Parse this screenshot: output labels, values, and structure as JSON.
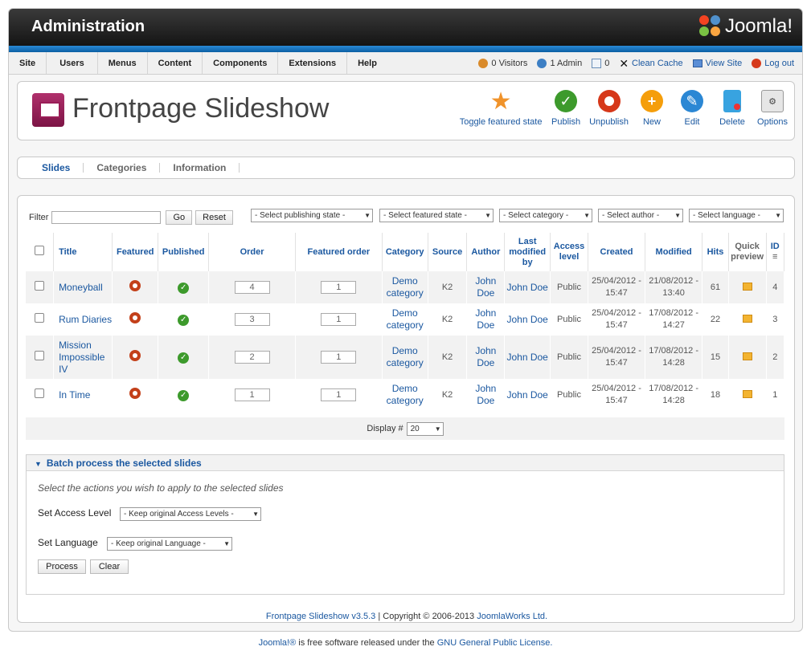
{
  "header": {
    "title": "Administration",
    "brand": "Joomla!"
  },
  "menu": [
    "Site",
    "Users",
    "Menus",
    "Content",
    "Components",
    "Extensions",
    "Help"
  ],
  "status": {
    "visitors": "0 Visitors",
    "admins": "1 Admin",
    "messages": "0",
    "clean_cache": "Clean Cache",
    "view_site": "View Site",
    "logout": "Log out"
  },
  "page_title": "Frontpage Slideshow",
  "toolbar": [
    {
      "label": "Toggle featured state",
      "icon": "star-icon"
    },
    {
      "label": "Publish",
      "icon": "check-icon"
    },
    {
      "label": "Unpublish",
      "icon": "unpublish-icon"
    },
    {
      "label": "New",
      "icon": "plus-icon"
    },
    {
      "label": "Edit",
      "icon": "pencil-icon"
    },
    {
      "label": "Delete",
      "icon": "trash-icon"
    },
    {
      "label": "Options",
      "icon": "options-icon"
    }
  ],
  "tabs": [
    "Slides",
    "Categories",
    "Information"
  ],
  "filter": {
    "label": "Filter",
    "go": "Go",
    "reset": "Reset",
    "selects": [
      "- Select publishing state -",
      "- Select featured state -",
      "- Select category -",
      "- Select author -",
      "- Select language -"
    ]
  },
  "columns": {
    "title": "Title",
    "featured": "Featured",
    "published": "Published",
    "order": "Order",
    "featured_order": "Featured order",
    "category": "Category",
    "source": "Source",
    "author": "Author",
    "last_modified_by": "Last modified by",
    "access": "Access level",
    "created": "Created",
    "modified": "Modified",
    "hits": "Hits",
    "quick_preview": "Quick preview",
    "id": "ID"
  },
  "rows": [
    {
      "title": "Moneyball",
      "order": "4",
      "featured_order": "1",
      "category": "Demo category",
      "source": "K2",
      "author": "John Doe",
      "modified_by": "John Doe",
      "access": "Public",
      "created": "25/04/2012 - 15:47",
      "modified": "21/08/2012 - 13:40",
      "hits": "61",
      "id": "4"
    },
    {
      "title": "Rum Diaries",
      "order": "3",
      "featured_order": "1",
      "category": "Demo category",
      "source": "K2",
      "author": "John Doe",
      "modified_by": "John Doe",
      "access": "Public",
      "created": "25/04/2012 - 15:47",
      "modified": "17/08/2012 - 14:27",
      "hits": "22",
      "id": "3"
    },
    {
      "title": "Mission Impossible IV",
      "order": "2",
      "featured_order": "1",
      "category": "Demo category",
      "source": "K2",
      "author": "John Doe",
      "modified_by": "John Doe",
      "access": "Public",
      "created": "25/04/2012 - 15:47",
      "modified": "17/08/2012 - 14:28",
      "hits": "15",
      "id": "2"
    },
    {
      "title": "In Time",
      "order": "1",
      "featured_order": "1",
      "category": "Demo category",
      "source": "K2",
      "author": "John Doe",
      "modified_by": "John Doe",
      "access": "Public",
      "created": "25/04/2012 - 15:47",
      "modified": "17/08/2012 - 14:28",
      "hits": "18",
      "id": "1"
    }
  ],
  "display": {
    "label": "Display #",
    "value": "20"
  },
  "batch": {
    "heading": "Batch process the selected slides",
    "description": "Select the actions you wish to apply to the selected slides",
    "access_label": "Set Access Level",
    "access_value": "- Keep original Access Levels -",
    "language_label": "Set Language",
    "language_value": "- Keep original Language -",
    "process": "Process",
    "clear": "Clear"
  },
  "footer": {
    "product": "Frontpage Slideshow v3.5.3",
    "copyright": "| Copyright © 2006-2013",
    "company": "JoomlaWorks Ltd.",
    "note_link1": "Joomla!®",
    "note_text": "is free software released under the",
    "note_link2": "GNU General Public License."
  },
  "colors": {
    "accent": "#1b58a0",
    "header_bg": "#1e1e1e",
    "blue_bar": "#0b5fa3"
  }
}
